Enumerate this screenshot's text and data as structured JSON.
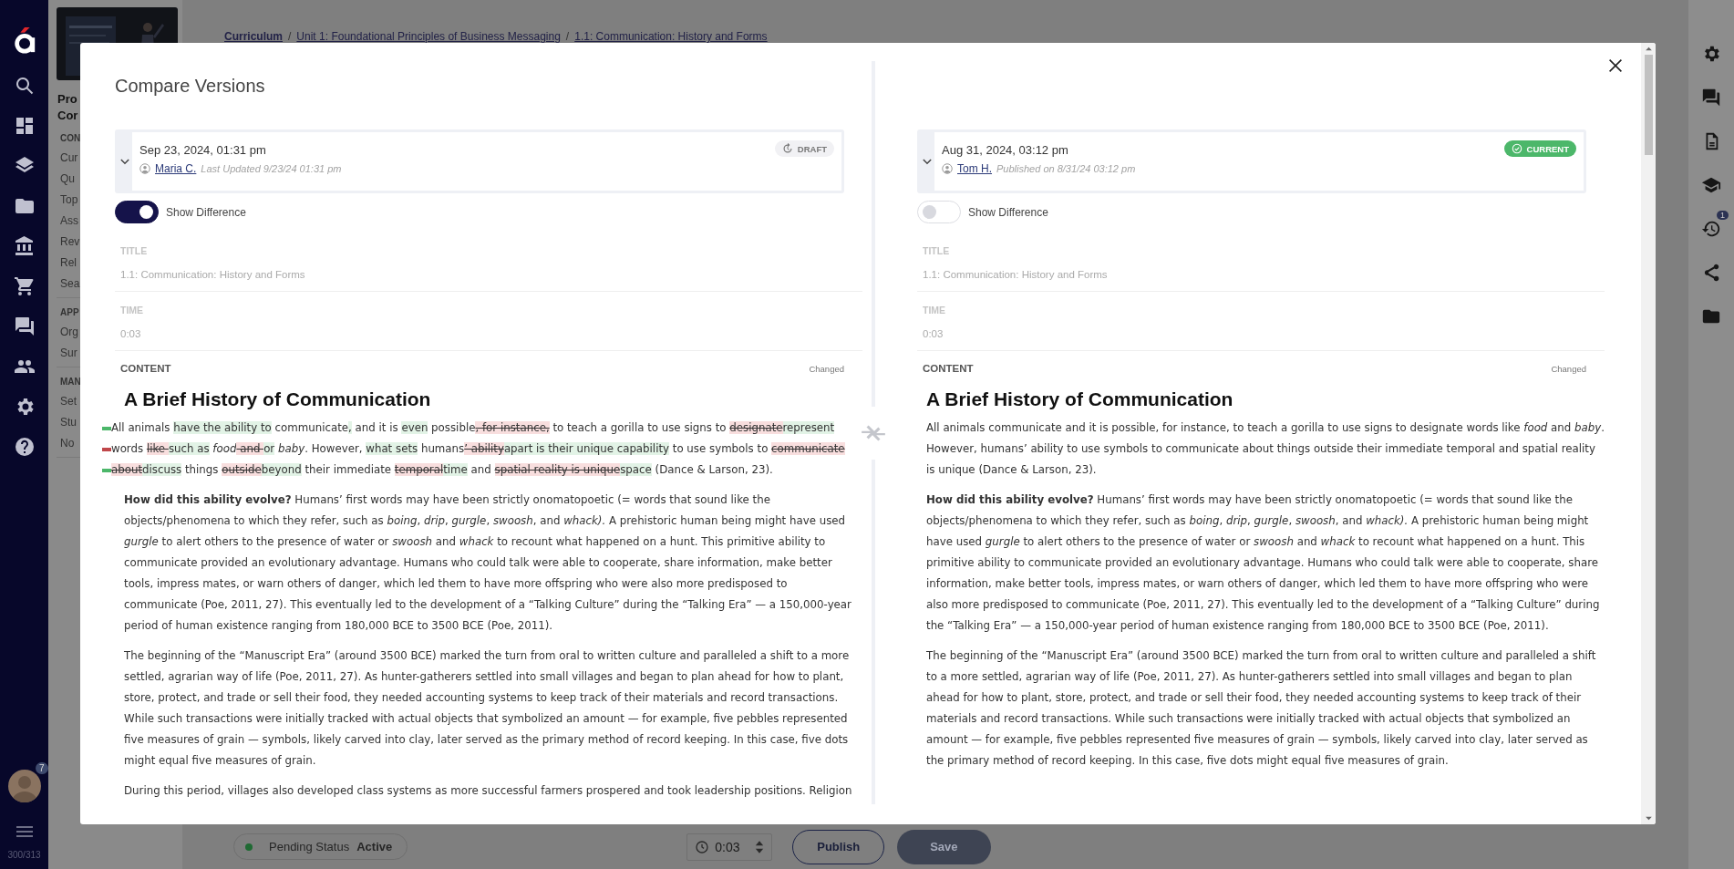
{
  "nav": {
    "badge": "7",
    "counter": "300/313"
  },
  "course_sidebar": {
    "title_lines": [
      "Pro",
      "Cor"
    ],
    "sections": [
      {
        "heading": "CON",
        "items": [
          "Cur",
          "Qu",
          "Top",
          "Ass",
          "Rev",
          "Rel",
          "Sea"
        ]
      },
      {
        "heading": "APP",
        "items": [
          "Org",
          "Sur"
        ]
      },
      {
        "heading": "MAN",
        "items": [
          "Set",
          "Stu",
          "No"
        ]
      }
    ]
  },
  "breadcrumb": {
    "separator": "/",
    "items": [
      "Curriculum",
      "Unit 1: Foundational Principles of Business Messaging",
      "1.1: Communication: History and Forms"
    ]
  },
  "right_rail": {
    "badge": "1"
  },
  "bottom_bar": {
    "status_label": "Pending Status",
    "status_value": "Active",
    "time": "0:03",
    "buttons": [
      {
        "label": "Publish",
        "kind": "outline",
        "disabled": false
      },
      {
        "label": "Save",
        "kind": "primary",
        "disabled": true
      }
    ]
  },
  "modal": {
    "title": "Compare Versions",
    "panes": [
      {
        "date": "Sep 23, 2024, 01:31 pm",
        "author": "Maria C.",
        "meta": "Last Updated 9/23/24 01:31 pm",
        "badge": {
          "label": "DRAFT",
          "kind": "draft"
        },
        "toggle_label": "Show Difference",
        "show_difference": true,
        "fields": [
          {
            "label": "TITLE",
            "value": "1.1: Communication: History and Forms"
          },
          {
            "label": "TIME",
            "value": "0:03"
          }
        ],
        "content_label": "CONTENT",
        "content_status": "Changed",
        "heading": "A Brief History of Communication",
        "change_marks": [
          {
            "kind": "added"
          },
          {
            "kind": "removed"
          },
          {
            "kind": "added"
          }
        ],
        "paragraphs": [
          {
            "kind": "diff",
            "segments": [
              {
                "kind": "same",
                "text": "All animals "
              },
              {
                "kind": "added",
                "text": "have the ability to"
              },
              {
                "kind": "same",
                "text": " communicate"
              },
              {
                "kind": "added",
                "text": ","
              },
              {
                "kind": "same",
                "text": " and it is "
              },
              {
                "kind": "added",
                "text": "even"
              },
              {
                "kind": "same",
                "text": " possible"
              },
              {
                "kind": "removed",
                "text": ", for instance,"
              },
              {
                "kind": "same",
                "text": " to teach a gorilla to use signs to "
              },
              {
                "kind": "removed",
                "text": "designate"
              },
              {
                "kind": "added",
                "text": "represent"
              },
              {
                "kind": "same",
                "text": " words "
              },
              {
                "kind": "removed",
                "text": "like "
              },
              {
                "kind": "added",
                "text": "such as"
              },
              {
                "kind": "same",
                "text": " *food*"
              },
              {
                "kind": "removed",
                "text": " and "
              },
              {
                "kind": "added",
                "text": " or"
              },
              {
                "kind": "same",
                "text": " *baby*. However, "
              },
              {
                "kind": "added",
                "text": "what sets"
              },
              {
                "kind": "same",
                "text": " humans"
              },
              {
                "kind": "removed",
                "text": "’ ability"
              },
              {
                "kind": "added",
                "text": "apart is their unique capability"
              },
              {
                "kind": "same",
                "text": " to use symbols to "
              },
              {
                "kind": "removed",
                "text": "communicate about"
              },
              {
                "kind": "added",
                "text": "discuss"
              },
              {
                "kind": "same",
                "text": " things "
              },
              {
                "kind": "removed",
                "text": "outside"
              },
              {
                "kind": "added",
                "text": "beyond"
              },
              {
                "kind": "same",
                "text": " their immediate "
              },
              {
                "kind": "removed",
                "text": "temporal"
              },
              {
                "kind": "added",
                "text": "time"
              },
              {
                "kind": "same",
                "text": " and "
              },
              {
                "kind": "removed",
                "text": "spatial reality is unique"
              },
              {
                "kind": "added",
                "text": "space"
              },
              {
                "kind": "same",
                "text": " (Dance & Larson, 23)."
              }
            ]
          },
          {
            "kind": "text",
            "text": "**How did this ability evolve?** Humans’ first words may have been strictly onomatopoetic (= words that sound like the objects/phenomena to which they refer, such as *boing*, *drip*, *gurgle*, *swoosh*, and *whack).* A prehistoric human being might have used *gurgle* to alert others to the presence of water or *swoosh* and *whack* to recount what happened on a hunt. This primitive ability to communicate provided an evolutionary advantage. Humans who could talk were able to cooperate, share information, make better tools, impress mates, or warn others of danger, which led them to have more offspring who were also more predisposed to communicate (Poe, 2011, 27). This eventually led to the development of a “Talking Culture” during the “Talking Era” — a 150,000-year period of human existence ranging from 180,000 BCE to 3500 BCE (Poe, 2011)."
          },
          {
            "kind": "text",
            "text": "The beginning of the “Manuscript Era” (around 3500 BCE) marked the turn from oral to written culture and paralleled a shift to a more settled, agrarian way of life (Poe, 2011, 27). As hunter-gatherers settled into small villages and began to plan ahead for how to plant, store, protect, and trade or sell their food, they needed accounting systems to keep track of their materials and record transactions. While such transactions were initially tracked with actual objects that symbolized an amount  — for example, five pebbles represented five measures of grain — symbols, likely carved into clay, later served as the primary method of record keeping. In this case, five dots might equal five measures of grain."
          },
          {
            "kind": "text",
            "text": "During this period, villages also developed class systems as more successful farmers prospered and took leadership positions. Religion"
          }
        ]
      },
      {
        "date": "Aug 31, 2024, 03:12 pm",
        "author": "Tom H.",
        "meta": "Published on 8/31/24 03:12 pm",
        "badge": {
          "label": "CURRENT",
          "kind": "current"
        },
        "toggle_label": "Show Difference",
        "show_difference": false,
        "fields": [
          {
            "label": "TITLE",
            "value": "1.1: Communication: History and Forms"
          },
          {
            "label": "TIME",
            "value": "0:03"
          }
        ],
        "content_label": "CONTENT",
        "content_status": "Changed",
        "heading": "A Brief History of Communication",
        "paragraphs": [
          {
            "kind": "text",
            "text": "All animals communicate and it is possible, for instance, to teach a gorilla to use signs to designate words like *food* and *baby*. However, humans’ ability to use symbols to communicate about things outside their immediate temporal and spatial reality is unique (Dance & Larson, 23)."
          },
          {
            "kind": "text",
            "text": "**How did this ability evolve?** Humans’ first words may have been strictly onomatopoetic (= words that sound like the objects/phenomena to which they refer, such as *boing*, *drip*, *gurgle*, *swoosh*, and *whack).* A prehistoric human being might have used *gurgle* to alert others to the presence of water or *swoosh* and *whack* to recount what happened on a hunt. This primitive ability to communicate provided an evolutionary advantage. Humans who could talk were able to cooperate, share information, make better tools, impress mates, or warn others of danger, which led them to have more offspring who were also more predisposed to communicate (Poe, 2011, 27). This eventually led to the development of a “Talking Culture” during the “Talking Era” — a 150,000-year period of human existence ranging from 180,000 BCE to 3500 BCE (Poe, 2011)."
          },
          {
            "kind": "text",
            "text": "The beginning of the “Manuscript Era” (around 3500 BCE) marked the turn from oral to written culture and paralleled a shift to a more settled, agrarian way of life (Poe, 2011, 27). As hunter-gatherers settled into small villages and began to plan ahead for how to plant, store, protect, and trade or sell their food, they needed accounting systems to keep track of their materials and record transactions. While such transactions were initially tracked with actual objects that symbolized an amount  — for example, five pebbles represented five measures of grain — symbols, likely carved into clay, later served as the primary method of record keeping. In this case, five dots might equal five measures of grain."
          }
        ]
      }
    ]
  }
}
